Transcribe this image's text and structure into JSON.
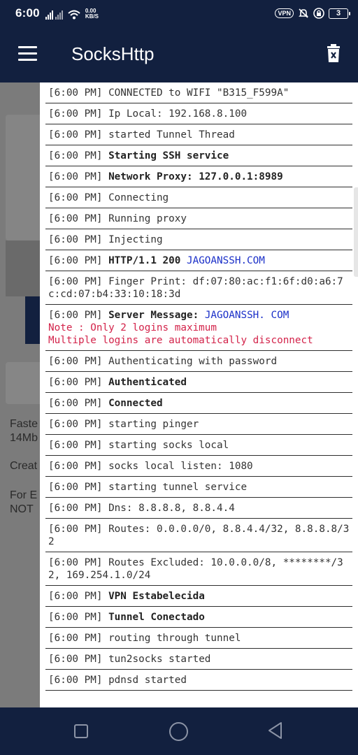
{
  "status_bar": {
    "time": "6:00",
    "net_speed_value": "0.00",
    "net_speed_unit": "KB/S",
    "vpn_label": "VPN",
    "battery": "3"
  },
  "app_bar": {
    "title": "SocksHttp",
    "menu_icon": "hamburger-menu-icon",
    "action_icon": "delete-log-icon"
  },
  "background": {
    "text_lines": [
      "Faste",
      "14Mb",
      "Creat",
      "For E",
      "NOT"
    ]
  },
  "log": {
    "entries": [
      {
        "time": "[6:00 PM]",
        "msg": "CONNECTED to WIFI \"B315_F599A\""
      },
      {
        "time": "[6:00 PM]",
        "msg": "Ip Local: 192.168.8.100"
      },
      {
        "time": "[6:00 PM]",
        "msg": "started Tunnel Thread"
      },
      {
        "time": "[6:00 PM]",
        "bold": "Starting SSH service"
      },
      {
        "time": "[6:00 PM]",
        "bold": "Network Proxy: 127.0.0.1:8989"
      },
      {
        "time": "[6:00 PM]",
        "msg": "Connecting"
      },
      {
        "time": "[6:00 PM]",
        "msg": "Running proxy"
      },
      {
        "time": "[6:00 PM]",
        "msg": "Injecting"
      },
      {
        "time": "[6:00 PM]",
        "bold": "HTTP/1.1 200",
        "link": "JAGOANSSH.COM"
      },
      {
        "time": "[6:00 PM]",
        "msg": "Finger Print: df:07:80:ac:f1:6f:d0:a6:7c:cd:07:b4:33:10:18:3d"
      },
      {
        "time": "[6:00 PM]",
        "bold": "Server Message:",
        "link": "JAGOANSSH. COM",
        "warn1": "Note : Only 2 logins maximum",
        "warn2": "Multiple logins are automatically disconnect"
      },
      {
        "time": "[6:00 PM]",
        "msg": "Authenticating with password"
      },
      {
        "time": "[6:00 PM]",
        "bold": "Authenticated"
      },
      {
        "time": "[6:00 PM]",
        "bold": "Connected"
      },
      {
        "time": "[6:00 PM]",
        "msg": "starting pinger"
      },
      {
        "time": "[6:00 PM]",
        "msg": "starting socks local"
      },
      {
        "time": "[6:00 PM]",
        "msg": "socks local listen: 1080"
      },
      {
        "time": "[6:00 PM]",
        "msg": "starting tunnel service"
      },
      {
        "time": "[6:00 PM]",
        "msg": "Dns: 8.8.8.8, 8.8.4.4"
      },
      {
        "time": "[6:00 PM]",
        "msg": "Routes: 0.0.0.0/0, 8.8.4.4/32, 8.8.8.8/32"
      },
      {
        "time": "[6:00 PM]",
        "msg": "Routes Excluded: 10.0.0.0/8, ********/32, 169.254.1.0/24"
      },
      {
        "time": "[6:00 PM]",
        "bold": "VPN Estabelecida"
      },
      {
        "time": "[6:00 PM]",
        "bold": "Tunnel Conectado"
      },
      {
        "time": "[6:00 PM]",
        "msg": "routing through tunnel"
      },
      {
        "time": "[6:00 PM]",
        "msg": "tun2socks started"
      },
      {
        "time": "[6:00 PM]",
        "msg": "pdnsd started"
      }
    ]
  },
  "nav_bar": {
    "recents_icon": "recents-square-icon",
    "home_icon": "home-circle-icon",
    "back_icon": "back-triangle-icon"
  },
  "colors": {
    "app_bar_bg": "#12203f",
    "link": "#1a2fc8",
    "warning": "#d3234a",
    "log_text": "#333333"
  }
}
